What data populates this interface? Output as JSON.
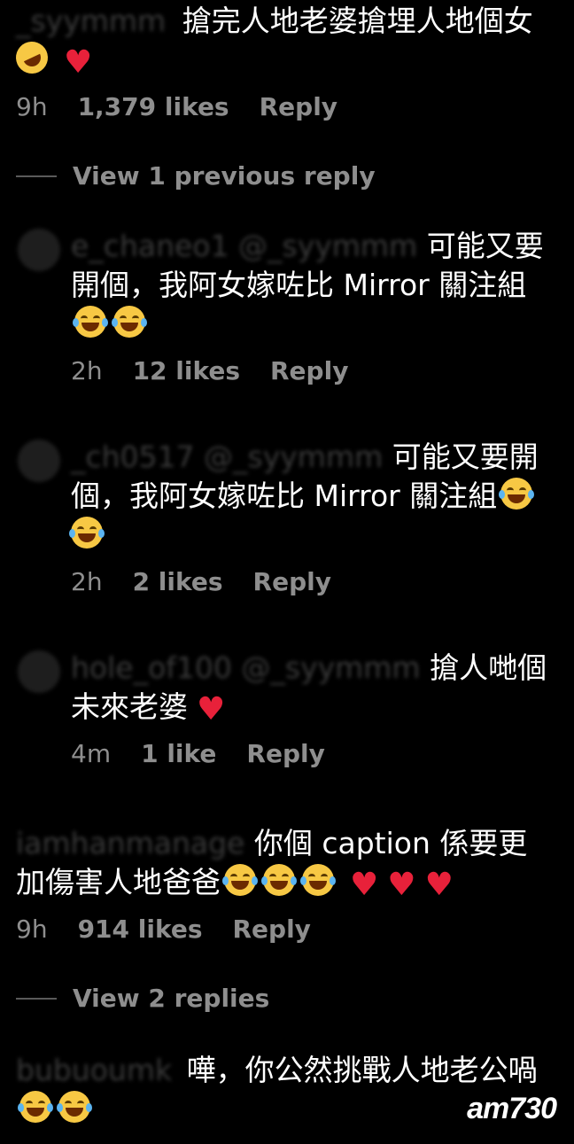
{
  "comments": [
    {
      "username": "_syymmm",
      "text": "搶完人地老婆搶埋人地個女",
      "time": "9h",
      "likes": "1,379 likes",
      "reply": "Reply"
    },
    {
      "username": "e_chaneo1",
      "mention": "@_syymmm",
      "text": "可能又要開個，我阿女嫁咗比 Mirror 關注組",
      "time": "2h",
      "likes": "12 likes",
      "reply": "Reply"
    },
    {
      "username": "_ch0517",
      "mention": "@_syymmm",
      "text": "可能又要開個，我阿女嫁咗比 Mirror 關注組",
      "time": "2h",
      "likes": "2 likes",
      "reply": "Reply"
    },
    {
      "username": "hole_of100",
      "mention": "@_syymmm",
      "text": "搶人哋個未來老婆",
      "time": "4m",
      "likes": "1 like",
      "reply": "Reply"
    },
    {
      "username": "iamhanmanage",
      "text": "你個 caption 係要更加傷害人地爸爸",
      "time": "9h",
      "likes": "914 likes",
      "reply": "Reply"
    },
    {
      "username": "bubuoumk",
      "text": "嘩，你公然挑戰人地老公喎"
    }
  ],
  "threads": {
    "view_previous": "View 1 previous reply",
    "view_replies": "View 2 replies"
  },
  "watermark": {
    "brand": "am730"
  },
  "colors": {
    "background": "#000000",
    "meta": "#8e8e8e",
    "heart": "#e8213a",
    "emoji": "#f7c844"
  }
}
